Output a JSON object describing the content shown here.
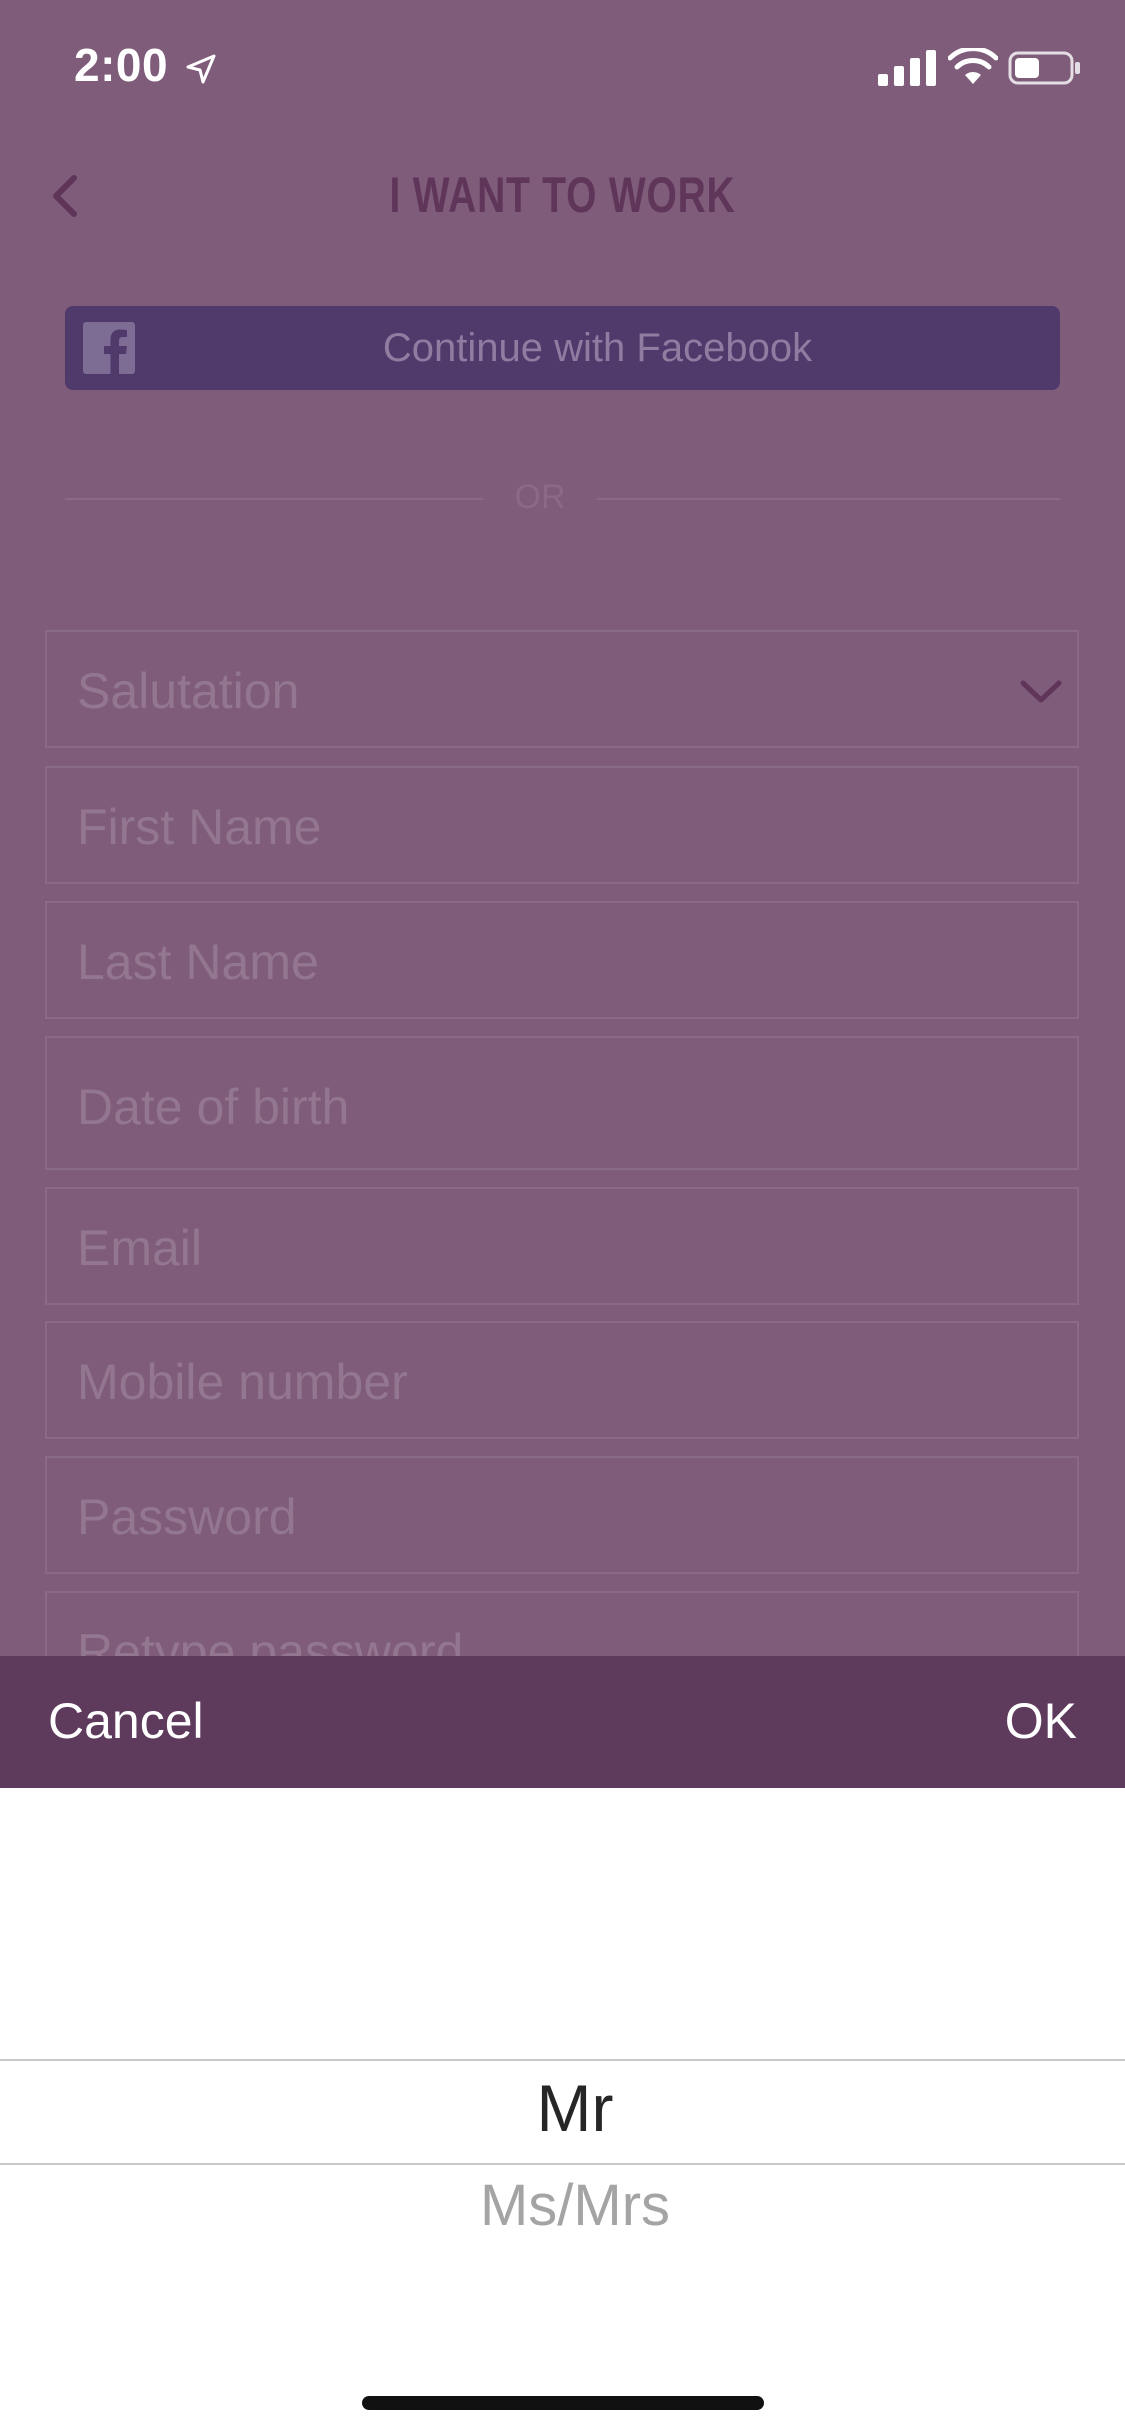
{
  "status_bar": {
    "time": "2:00",
    "icons": [
      "location-arrow-icon",
      "cellular-signal-icon",
      "wifi-icon",
      "battery-icon"
    ]
  },
  "header": {
    "title": "I WANT TO WORK",
    "back_icon": "chevron-left-icon"
  },
  "facebook_button": {
    "label": "Continue with Facebook",
    "icon": "facebook-icon"
  },
  "divider": {
    "label": "OR"
  },
  "form": {
    "salutation": {
      "placeholder": "Salutation",
      "icon": "chevron-down-icon"
    },
    "first_name": {
      "placeholder": "First Name"
    },
    "last_name": {
      "placeholder": "Last Name"
    },
    "date_of_birth": {
      "placeholder": "Date of birth"
    },
    "email": {
      "placeholder": "Email"
    },
    "mobile": {
      "placeholder": "Mobile number"
    },
    "password": {
      "placeholder": "Password"
    },
    "retype_password": {
      "placeholder": "Retype password"
    }
  },
  "picker": {
    "cancel_label": "Cancel",
    "ok_label": "OK",
    "options": [
      "Mr",
      "Ms/Mrs"
    ],
    "selected": "Mr"
  },
  "colors": {
    "overlay_background": "#7e5c7a",
    "title": "#5f3559",
    "facebook_button": "#4f3a6b",
    "picker_toolbar": "#5e3a5c",
    "picker_background": "#ffffff"
  }
}
